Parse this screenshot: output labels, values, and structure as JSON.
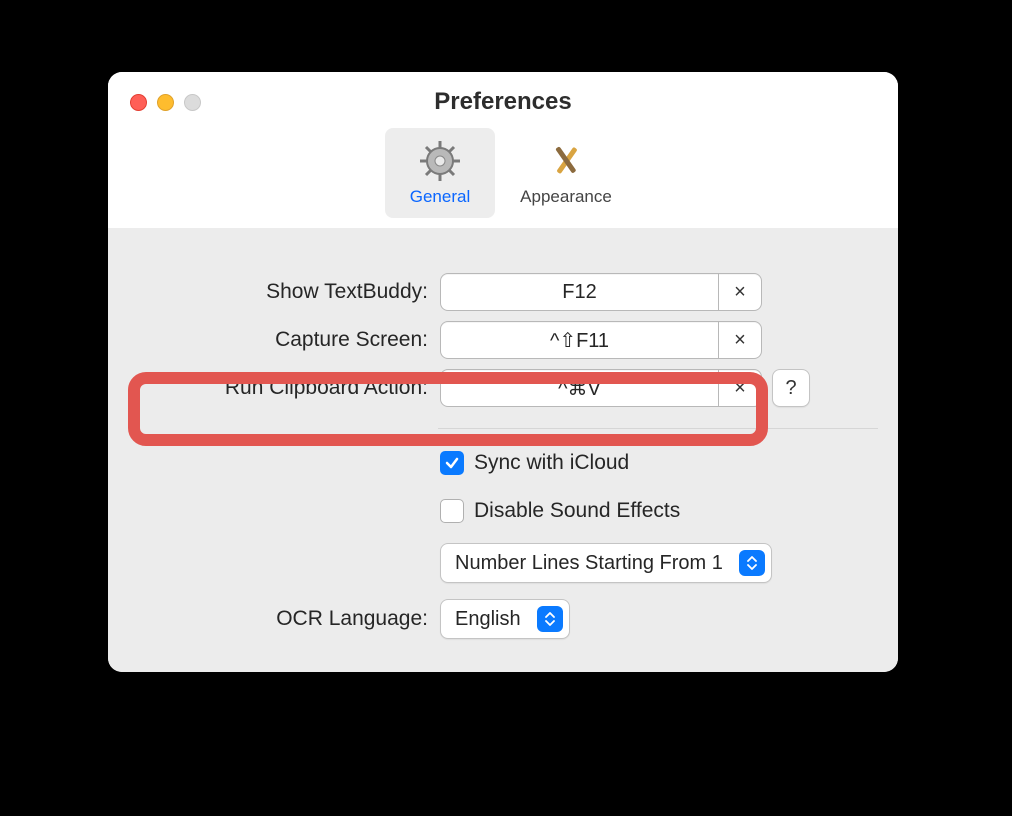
{
  "window": {
    "title": "Preferences",
    "tabs": [
      {
        "id": "general",
        "label": "General",
        "active": true
      },
      {
        "id": "appearance",
        "label": "Appearance",
        "active": false
      }
    ]
  },
  "shortcuts": [
    {
      "id": "show",
      "label": "Show TextBuddy:",
      "value": "F12",
      "help": false
    },
    {
      "id": "capture",
      "label": "Capture Screen:",
      "value": "^⇧F11",
      "help": false
    },
    {
      "id": "clipboard",
      "label": "Run Clipboard Action:",
      "value": "^⌘V",
      "help": true,
      "highlighted": true
    }
  ],
  "checkboxes": [
    {
      "id": "sync",
      "label": "Sync with iCloud",
      "checked": true
    },
    {
      "id": "sound",
      "label": "Disable Sound Effects",
      "checked": false
    }
  ],
  "numberLines": {
    "label": "Number Lines Starting From 1"
  },
  "ocr": {
    "label": "OCR Language:",
    "value": "English"
  },
  "help_glyph": "?",
  "clear_glyph": "×"
}
